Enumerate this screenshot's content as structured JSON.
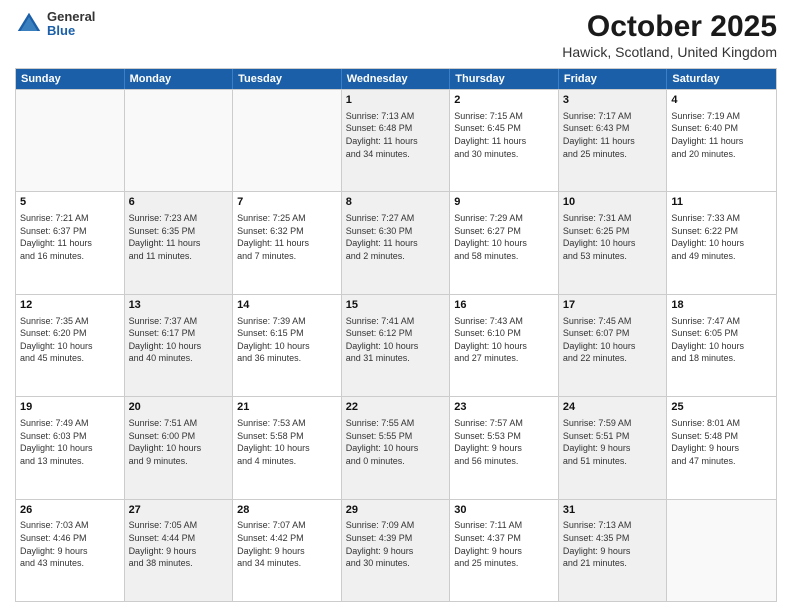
{
  "header": {
    "logo": {
      "general": "General",
      "blue": "Blue"
    },
    "title": "October 2025",
    "location": "Hawick, Scotland, United Kingdom"
  },
  "days_of_week": [
    "Sunday",
    "Monday",
    "Tuesday",
    "Wednesday",
    "Thursday",
    "Friday",
    "Saturday"
  ],
  "weeks": [
    [
      {
        "day": "",
        "content": "",
        "empty": true
      },
      {
        "day": "",
        "content": "",
        "empty": true
      },
      {
        "day": "",
        "content": "",
        "empty": true
      },
      {
        "day": "1",
        "content": "Sunrise: 7:13 AM\nSunset: 6:48 PM\nDaylight: 11 hours\nand 34 minutes.",
        "shaded": true
      },
      {
        "day": "2",
        "content": "Sunrise: 7:15 AM\nSunset: 6:45 PM\nDaylight: 11 hours\nand 30 minutes.",
        "shaded": false
      },
      {
        "day": "3",
        "content": "Sunrise: 7:17 AM\nSunset: 6:43 PM\nDaylight: 11 hours\nand 25 minutes.",
        "shaded": true
      },
      {
        "day": "4",
        "content": "Sunrise: 7:19 AM\nSunset: 6:40 PM\nDaylight: 11 hours\nand 20 minutes.",
        "shaded": false
      }
    ],
    [
      {
        "day": "5",
        "content": "Sunrise: 7:21 AM\nSunset: 6:37 PM\nDaylight: 11 hours\nand 16 minutes.",
        "shaded": false
      },
      {
        "day": "6",
        "content": "Sunrise: 7:23 AM\nSunset: 6:35 PM\nDaylight: 11 hours\nand 11 minutes.",
        "shaded": true
      },
      {
        "day": "7",
        "content": "Sunrise: 7:25 AM\nSunset: 6:32 PM\nDaylight: 11 hours\nand 7 minutes.",
        "shaded": false
      },
      {
        "day": "8",
        "content": "Sunrise: 7:27 AM\nSunset: 6:30 PM\nDaylight: 11 hours\nand 2 minutes.",
        "shaded": true
      },
      {
        "day": "9",
        "content": "Sunrise: 7:29 AM\nSunset: 6:27 PM\nDaylight: 10 hours\nand 58 minutes.",
        "shaded": false
      },
      {
        "day": "10",
        "content": "Sunrise: 7:31 AM\nSunset: 6:25 PM\nDaylight: 10 hours\nand 53 minutes.",
        "shaded": true
      },
      {
        "day": "11",
        "content": "Sunrise: 7:33 AM\nSunset: 6:22 PM\nDaylight: 10 hours\nand 49 minutes.",
        "shaded": false
      }
    ],
    [
      {
        "day": "12",
        "content": "Sunrise: 7:35 AM\nSunset: 6:20 PM\nDaylight: 10 hours\nand 45 minutes.",
        "shaded": false
      },
      {
        "day": "13",
        "content": "Sunrise: 7:37 AM\nSunset: 6:17 PM\nDaylight: 10 hours\nand 40 minutes.",
        "shaded": true
      },
      {
        "day": "14",
        "content": "Sunrise: 7:39 AM\nSunset: 6:15 PM\nDaylight: 10 hours\nand 36 minutes.",
        "shaded": false
      },
      {
        "day": "15",
        "content": "Sunrise: 7:41 AM\nSunset: 6:12 PM\nDaylight: 10 hours\nand 31 minutes.",
        "shaded": true
      },
      {
        "day": "16",
        "content": "Sunrise: 7:43 AM\nSunset: 6:10 PM\nDaylight: 10 hours\nand 27 minutes.",
        "shaded": false
      },
      {
        "day": "17",
        "content": "Sunrise: 7:45 AM\nSunset: 6:07 PM\nDaylight: 10 hours\nand 22 minutes.",
        "shaded": true
      },
      {
        "day": "18",
        "content": "Sunrise: 7:47 AM\nSunset: 6:05 PM\nDaylight: 10 hours\nand 18 minutes.",
        "shaded": false
      }
    ],
    [
      {
        "day": "19",
        "content": "Sunrise: 7:49 AM\nSunset: 6:03 PM\nDaylight: 10 hours\nand 13 minutes.",
        "shaded": false
      },
      {
        "day": "20",
        "content": "Sunrise: 7:51 AM\nSunset: 6:00 PM\nDaylight: 10 hours\nand 9 minutes.",
        "shaded": true
      },
      {
        "day": "21",
        "content": "Sunrise: 7:53 AM\nSunset: 5:58 PM\nDaylight: 10 hours\nand 4 minutes.",
        "shaded": false
      },
      {
        "day": "22",
        "content": "Sunrise: 7:55 AM\nSunset: 5:55 PM\nDaylight: 10 hours\nand 0 minutes.",
        "shaded": true
      },
      {
        "day": "23",
        "content": "Sunrise: 7:57 AM\nSunset: 5:53 PM\nDaylight: 9 hours\nand 56 minutes.",
        "shaded": false
      },
      {
        "day": "24",
        "content": "Sunrise: 7:59 AM\nSunset: 5:51 PM\nDaylight: 9 hours\nand 51 minutes.",
        "shaded": true
      },
      {
        "day": "25",
        "content": "Sunrise: 8:01 AM\nSunset: 5:48 PM\nDaylight: 9 hours\nand 47 minutes.",
        "shaded": false
      }
    ],
    [
      {
        "day": "26",
        "content": "Sunrise: 7:03 AM\nSunset: 4:46 PM\nDaylight: 9 hours\nand 43 minutes.",
        "shaded": false
      },
      {
        "day": "27",
        "content": "Sunrise: 7:05 AM\nSunset: 4:44 PM\nDaylight: 9 hours\nand 38 minutes.",
        "shaded": true
      },
      {
        "day": "28",
        "content": "Sunrise: 7:07 AM\nSunset: 4:42 PM\nDaylight: 9 hours\nand 34 minutes.",
        "shaded": false
      },
      {
        "day": "29",
        "content": "Sunrise: 7:09 AM\nSunset: 4:39 PM\nDaylight: 9 hours\nand 30 minutes.",
        "shaded": true
      },
      {
        "day": "30",
        "content": "Sunrise: 7:11 AM\nSunset: 4:37 PM\nDaylight: 9 hours\nand 25 minutes.",
        "shaded": false
      },
      {
        "day": "31",
        "content": "Sunrise: 7:13 AM\nSunset: 4:35 PM\nDaylight: 9 hours\nand 21 minutes.",
        "shaded": true
      },
      {
        "day": "",
        "content": "",
        "empty": true
      }
    ]
  ]
}
